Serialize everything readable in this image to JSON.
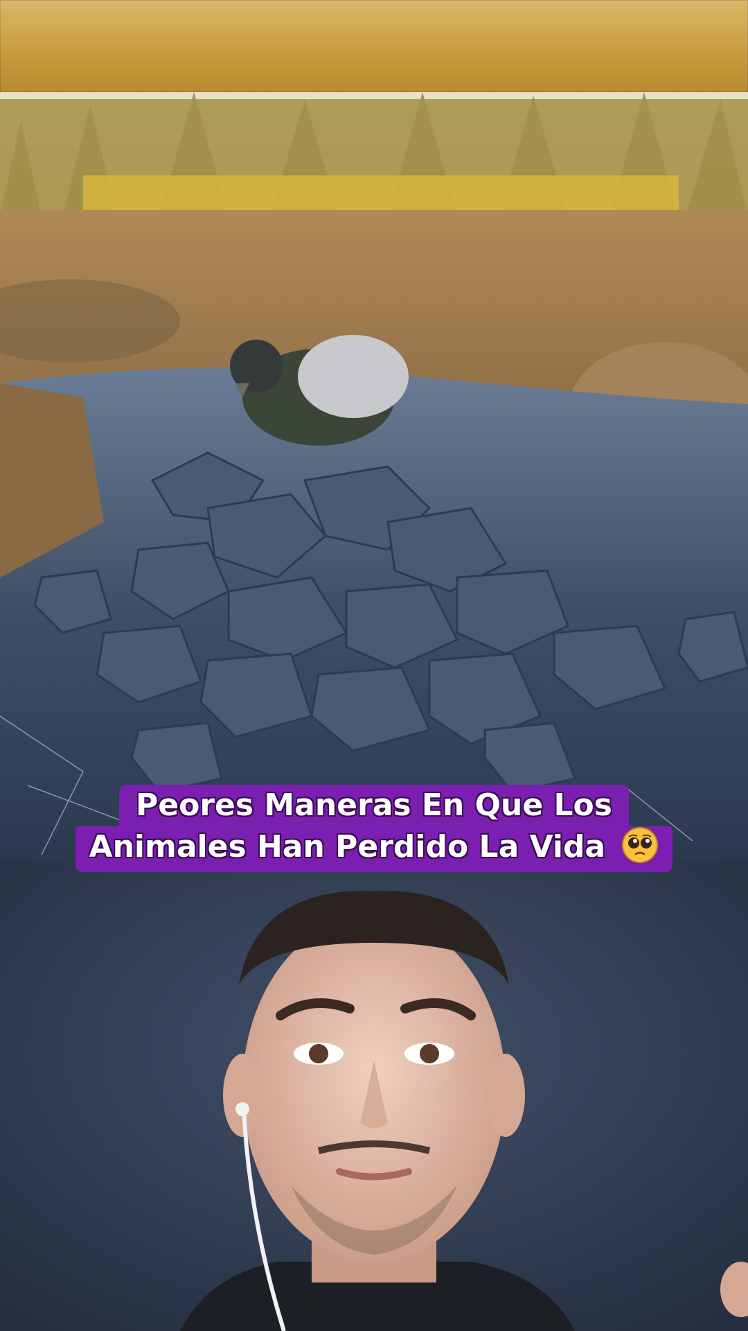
{
  "caption": {
    "line1": "Peores Maneras En Que Los",
    "line2": "Animales Han Perdido La Vida"
  },
  "icons": {
    "caption_emoji": "pleading-face-emoji"
  },
  "colors": {
    "caption_background": "#7a1fb0",
    "caption_text": "#ffffff"
  }
}
